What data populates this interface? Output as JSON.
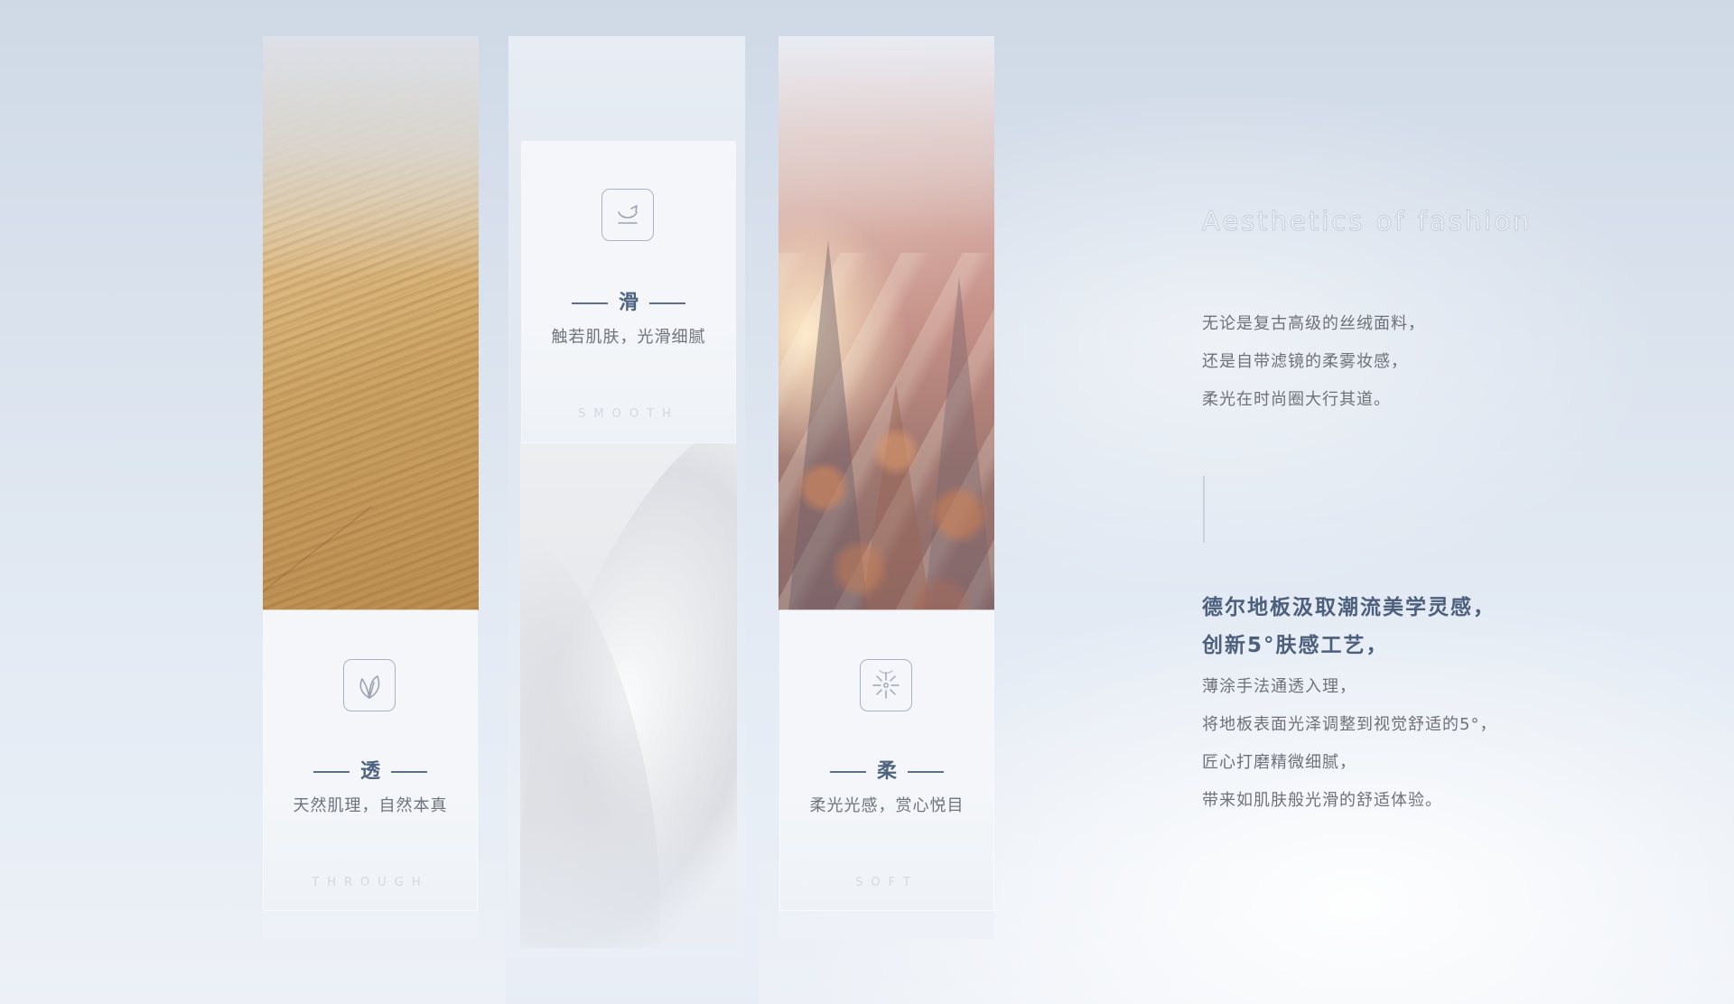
{
  "columns": [
    {
      "title": "透",
      "subtitle": "天然肌理，自然本真",
      "english": "THROUGH",
      "icon": "leaf-icon"
    },
    {
      "title": "滑",
      "subtitle": "触若肌肤，光滑细腻",
      "english": "SMOOTH",
      "icon": "smooth-surface-icon"
    },
    {
      "title": "柔",
      "subtitle": "柔光光感，赏心悦目",
      "english": "SOFT",
      "icon": "soft-light-icon"
    }
  ],
  "right": {
    "heading": "Aesthetics of fashion",
    "paragraph1": [
      "无论是复古高级的丝绒面料，",
      "还是自带滤镜的柔雾妆感，",
      "柔光在时尚圈大行其道。"
    ],
    "bold": [
      "德尔地板汲取潮流美学灵感，",
      "创新5°肤感工艺，"
    ],
    "paragraph2": [
      "薄涂手法通透入理，",
      "将地板表面光泽调整到视觉舒适的5°，",
      "匠心打磨精微细腻，",
      "带来如肌肤般光滑的舒适体验。"
    ]
  }
}
